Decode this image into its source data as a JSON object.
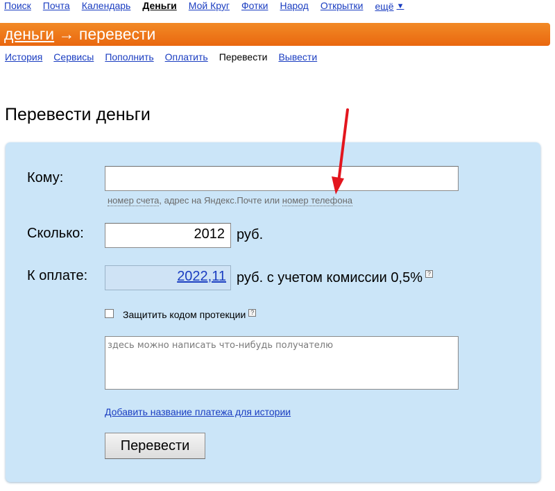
{
  "topnav": {
    "items": [
      "Поиск",
      "Почта",
      "Календарь",
      "Деньги",
      "Мой Круг",
      "Фотки",
      "Народ",
      "Открытки"
    ],
    "more": "ещё",
    "more_caret": "▼"
  },
  "header": {
    "service_link": "деньги",
    "arrow": "→",
    "section": "перевести"
  },
  "subnav": {
    "items": [
      "История",
      "Сервисы",
      "Пополнить",
      "Оплатить",
      "Перевести",
      "Вывести"
    ],
    "current_index": 4
  },
  "page_title": "Перевести деньги",
  "form": {
    "to_label": "Кому:",
    "to_value": "",
    "to_hint_part1": "номер счета",
    "to_hint_part2": ", адрес на Яндекс.Почте или ",
    "to_hint_part3": "номер телефона",
    "amount_label": "Сколько:",
    "amount_value": "2012",
    "amount_unit": "руб.",
    "pay_label": "К оплате:",
    "pay_value": "2022,11",
    "pay_unit": "руб. с учетом комиссии 0,5%",
    "help_glyph": "?",
    "protect_label": "Защитить кодом протекции",
    "protect_checked": false,
    "message_placeholder": "здесь можно написать что-нибудь получателю",
    "add_name_link": "Добавить название платежа для истории",
    "submit_label": "Перевести"
  },
  "colors": {
    "link": "#1a3dc1",
    "header_orange": "#ee7a1b",
    "panel": "#cbe5f8",
    "annotation_red": "#e3161e"
  }
}
